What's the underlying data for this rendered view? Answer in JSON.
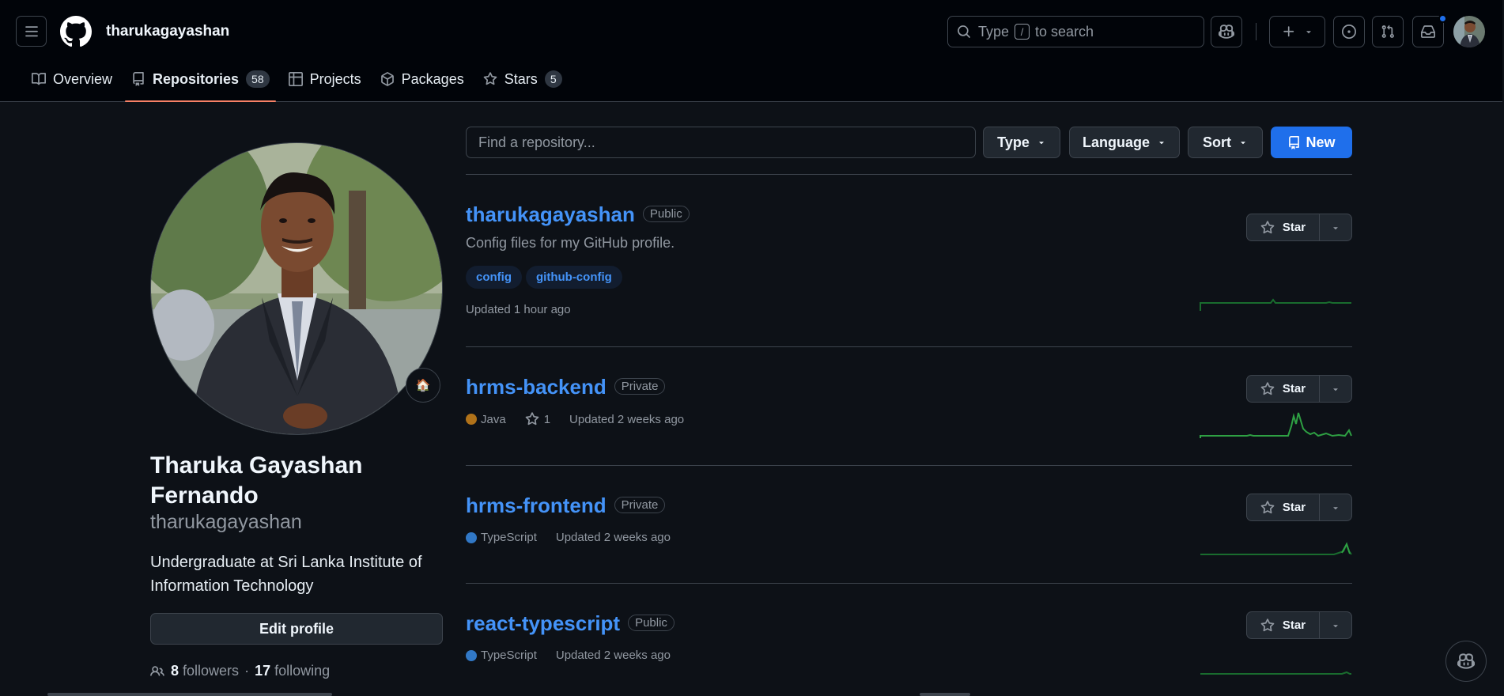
{
  "header": {
    "username": "tharukagayashan",
    "search_prefix": "Type",
    "search_key": "/",
    "search_suffix": "to search"
  },
  "tabs": [
    {
      "label": "Overview",
      "icon": "book-icon",
      "count": null
    },
    {
      "label": "Repositories",
      "icon": "repo-icon",
      "count": "58",
      "active": true
    },
    {
      "label": "Projects",
      "icon": "table-icon",
      "count": null
    },
    {
      "label": "Packages",
      "icon": "package-icon",
      "count": null
    },
    {
      "label": "Stars",
      "icon": "star-icon",
      "count": "5"
    }
  ],
  "profile": {
    "full_name": "Tharuka Gayashan Fernando",
    "login": "tharukagayashan",
    "bio": "Undergraduate at Sri Lanka Institute of Information Technology",
    "status_emoji": "🏠",
    "edit_label": "Edit profile",
    "followers_count": "8",
    "followers_label": "followers",
    "following_count": "17",
    "following_label": "following"
  },
  "filters": {
    "find_placeholder": "Find a repository...",
    "type_label": "Type",
    "language_label": "Language",
    "sort_label": "Sort",
    "new_label": "New"
  },
  "repos": [
    {
      "name": "tharukagayashan",
      "visibility": "Public",
      "description": "Config files for my GitHub profile.",
      "topics": [
        "config",
        "github-config"
      ],
      "updated": "Updated 1 hour ago",
      "star_label": "Star"
    },
    {
      "name": "hrms-backend",
      "visibility": "Private",
      "language": "Java",
      "language_color": "#b07219",
      "stars": "1",
      "updated": "Updated 2 weeks ago",
      "star_label": "Star"
    },
    {
      "name": "hrms-frontend",
      "visibility": "Private",
      "language": "TypeScript",
      "language_color": "#3178c6",
      "updated": "Updated 2 weeks ago",
      "star_label": "Star"
    },
    {
      "name": "react-typescript",
      "visibility": "Public",
      "language": "TypeScript",
      "language_color": "#3178c6",
      "updated": "Updated 2 weeks ago",
      "star_label": "Star"
    }
  ],
  "colors": {
    "accent": "#1f6feb",
    "link": "#4493f8",
    "tab_underline": "#f78166",
    "sparkline": "#2ea043"
  }
}
